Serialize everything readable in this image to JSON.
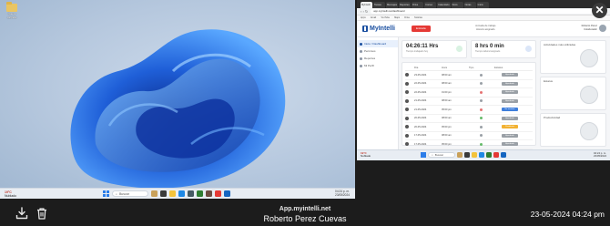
{
  "viewer": {
    "host": "App.myintelli.net",
    "user_name": "Roberto Perez Cuevas",
    "datetime": "23-05-2024 04:24 pm",
    "download_icon": "download-tray-icon",
    "delete_icon": "trash-icon",
    "close_icon": "close-x-icon"
  },
  "desktop_left": {
    "desktop_icon_label": "Nueva carpeta",
    "weather_temp": "19°C",
    "weather_text": "Nublado",
    "search_placeholder": "Buscar",
    "clock_time": "04:24 p. m.",
    "clock_date": "23/05/2024"
  },
  "browser": {
    "tabs": [
      "MyIntelli",
      "Tareas",
      "Mensajes",
      "Reportes",
      "Drive",
      "Correo",
      "Calendario",
      "Docs",
      "Notas",
      "Inicio"
    ],
    "url": "app.myintelli.net/dashboard",
    "bookmarks": [
      "Apps",
      "Gmail",
      "YouTube",
      "Maps",
      "Drive",
      "Noticias"
    ]
  },
  "myintelli": {
    "brand": "MyIntelli",
    "header_button": "Entrada",
    "header_center_line1": "Jornada de trabajo",
    "header_center_line2": "Horario asignado",
    "user_line1": "Roberto Perez",
    "user_line2": "Colaborador",
    "sidebar": [
      "Inicio / Dashboard",
      "Permisos",
      "Reportes",
      "Mi Perfil"
    ],
    "kpis": [
      {
        "value": "04:26:11 Hrs",
        "label": "Tiempo trabajado hoy"
      },
      {
        "value": "8 hrs 0 min",
        "label": "Tiempo laboral asignado"
      }
    ],
    "table_headers": [
      "",
      "Día",
      "Hora",
      "Tipo",
      "Estatus"
    ],
    "rows": [
      {
        "day": "23-05-2024",
        "time": "08:00 am",
        "status_color": "#9aa0a6",
        "badge": "Aprobado",
        "badge_color": "#9aa0a6"
      },
      {
        "day": "22-05-2024",
        "time": "08:00 am",
        "status_color": "#9aa0a6",
        "badge": "Aprobado",
        "badge_color": "#9aa0a6"
      },
      {
        "day": "22-05-2024",
        "time": "01:00 pm",
        "status_color": "#e57373",
        "badge": "Aprobado",
        "badge_color": "#9aa0a6"
      },
      {
        "day": "21-05-2024",
        "time": "08:00 am",
        "status_color": "#9aa0a6",
        "badge": "Aprobado",
        "badge_color": "#9aa0a6"
      },
      {
        "day": "21-05-2024",
        "time": "05:00 pm",
        "status_color": "#e57373",
        "badge": "En revisión",
        "badge_color": "#3f7fdc"
      },
      {
        "day": "20-05-2024",
        "time": "08:00 am",
        "status_color": "#66bb6a",
        "badge": "Aprobado",
        "badge_color": "#9aa0a6"
      },
      {
        "day": "20-05-2024",
        "time": "05:00 pm",
        "status_color": "#9aa0a6",
        "badge": "Pendiente",
        "badge_color": "#f2b233"
      },
      {
        "day": "17-05-2024",
        "time": "08:00 am",
        "status_color": "#9aa0a6",
        "badge": "Aprobado",
        "badge_color": "#9aa0a6"
      },
      {
        "day": "17-05-2024",
        "time": "05:00 pm",
        "status_color": "#66bb6a",
        "badge": "Aprobado",
        "badge_color": "#9aa0a6"
      }
    ],
    "right_cards": [
      "Actividades más utilizadas",
      "Estatus",
      "Productividad"
    ]
  },
  "desktop_right": {
    "weather_temp": "19°C",
    "weather_text": "Nublado",
    "search_placeholder": "Buscar",
    "clock_time": "04:24 p. m.",
    "clock_date": "23/05/2024"
  }
}
